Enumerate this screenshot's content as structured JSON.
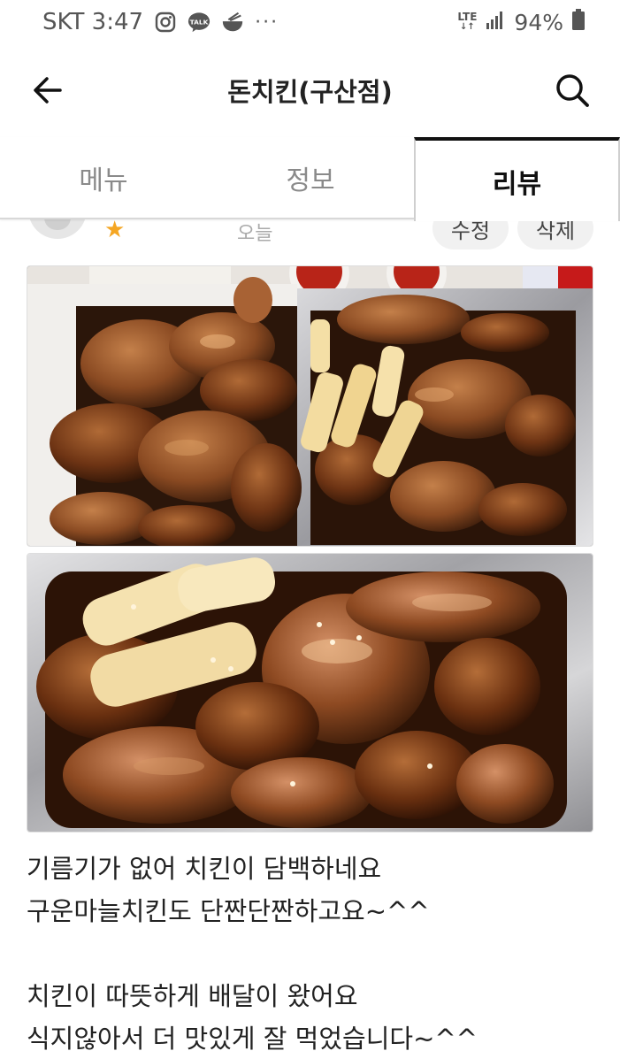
{
  "status_bar": {
    "carrier_time": "SKT 3:47",
    "more_indicator": "···",
    "network": "LTE",
    "battery": "94%",
    "icons": [
      "instagram-icon",
      "kakaotalk-icon",
      "food-bowl-icon",
      "signal-icon",
      "battery-icon"
    ]
  },
  "header": {
    "title": "돈치킨(구산점)",
    "back_icon": "arrow-left-icon",
    "search_icon": "search-icon"
  },
  "tabs": [
    {
      "label": "메뉴",
      "active": false
    },
    {
      "label": "정보",
      "active": false
    },
    {
      "label": "리뷰",
      "active": true
    }
  ],
  "review": {
    "rating_stars": 1,
    "date": "오늘",
    "edit_label": "수정",
    "delete_label": "삭제",
    "photo_count": 2,
    "text_lines": [
      "기름기가 없어 치킨이 담백하네요",
      "구운마늘치킨도 단짠단짠하고요~^^",
      "",
      "치킨이 따뜻하게 배달이 왔어요",
      "식지않아서 더 맛있게 잘 먹었습니다~^^"
    ]
  },
  "colors": {
    "star": "#f5a623",
    "active_tab": "#111111",
    "inactive_tab": "#8a8a8a"
  }
}
